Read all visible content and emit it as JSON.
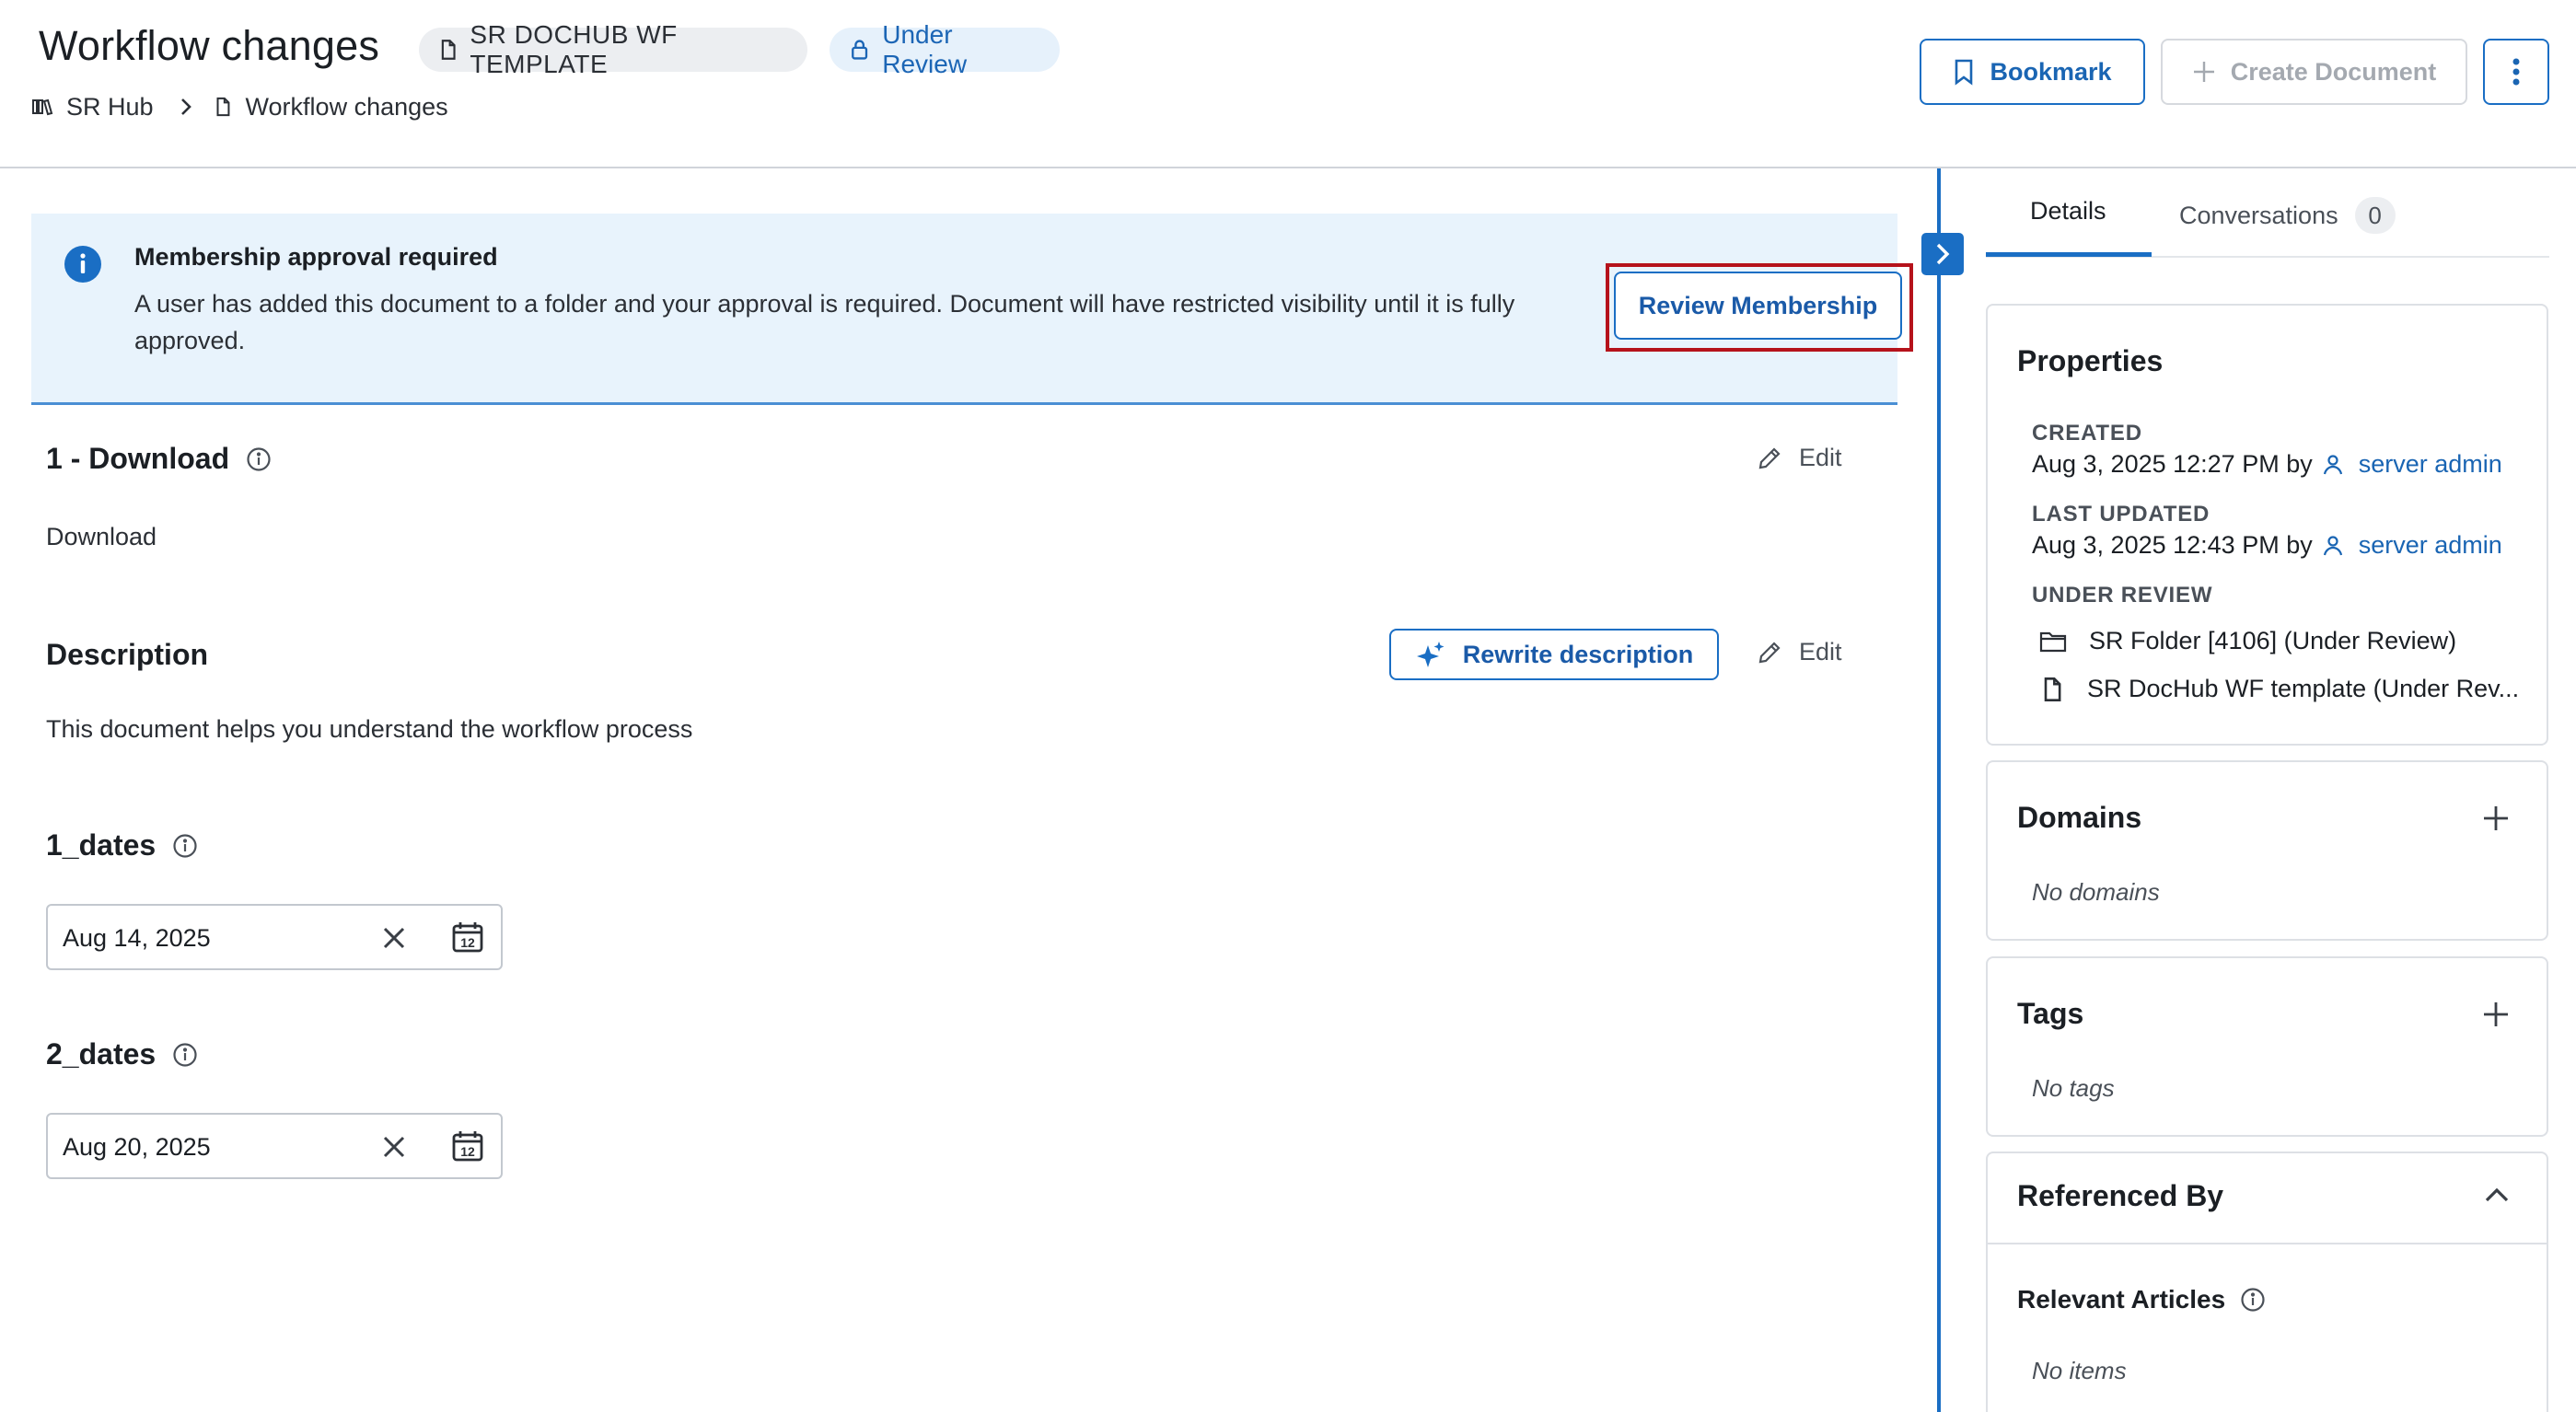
{
  "header": {
    "title": "Workflow changes",
    "template_chip": "SR DOCHUB WF TEMPLATE",
    "status_chip": "Under Review",
    "breadcrumb": {
      "root": "SR Hub",
      "current": "Workflow changes"
    },
    "bookmark_label": "Bookmark",
    "create_label": "Create Document"
  },
  "banner": {
    "title": "Membership approval required",
    "text": "A user has added this document to a folder and your approval is required. Document will have restricted visibility until it is fully approved.",
    "button_label": "Review Membership"
  },
  "sections": {
    "download": {
      "title": "1 - Download",
      "value": "Download",
      "edit_label": "Edit"
    },
    "description": {
      "title": "Description",
      "value": "This document helps you understand the workflow process",
      "rewrite_label": "Rewrite description",
      "edit_label": "Edit"
    },
    "dates1": {
      "title": "1_dates",
      "value": "Aug 14, 2025"
    },
    "dates2": {
      "title": "2_dates",
      "value": "Aug 20, 2025"
    }
  },
  "panel": {
    "tabs": {
      "details": "Details",
      "conversations": "Conversations",
      "conversations_count": "0"
    },
    "properties": {
      "title": "Properties",
      "created_label": "CREATED",
      "created_value": "Aug 3, 2025 12:27 PM by",
      "created_by": "server admin",
      "updated_label": "LAST UPDATED",
      "updated_value": "Aug 3, 2025 12:43 PM by",
      "updated_by": "server admin",
      "review_label": "UNDER REVIEW",
      "review_items": [
        "SR Folder [4106] (Under Review)",
        "SR DocHub WF template (Under Rev..."
      ]
    },
    "domains": {
      "title": "Domains",
      "empty": "No domains"
    },
    "tags": {
      "title": "Tags",
      "empty": "No tags"
    },
    "referenced": {
      "title": "Referenced By",
      "sub_title": "Relevant Articles",
      "empty": "No items"
    }
  },
  "colors": {
    "accent": "#1a6ec4",
    "highlight": "#b5121b",
    "banner_bg": "#e8f3fc"
  }
}
